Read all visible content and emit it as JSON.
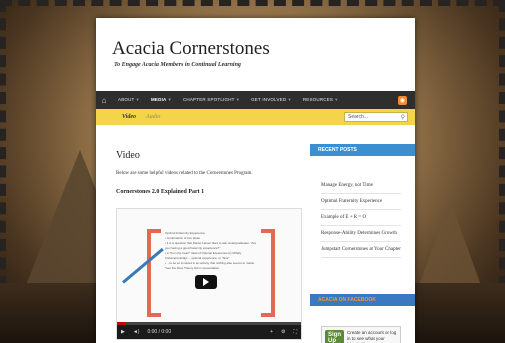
{
  "site": {
    "title": "Acacia Cornerstones",
    "tagline": "To Engage Acacia Members in Continual Learning"
  },
  "nav": {
    "home_icon": "home-icon",
    "items": [
      {
        "label": "ABOUT",
        "caret": "▾"
      },
      {
        "label": "MEDIA",
        "caret": "▾"
      },
      {
        "label": "CHAPTER SPOTLIGHT",
        "caret": "▾"
      },
      {
        "label": "GET INVOLVED",
        "caret": "▾"
      },
      {
        "label": "RESOURCES",
        "caret": "▾"
      }
    ],
    "rss_icon": "rss-icon"
  },
  "subnav": {
    "items": [
      "Video",
      "Audio"
    ],
    "search_placeholder": "Search..."
  },
  "main": {
    "heading": "Video",
    "intro": "Below are some helpful videos related to the Cornerstones Program.",
    "video_title": "Cornerstones 2.0 Explained Part 1"
  },
  "video": {
    "time": "0:00 / 0:00",
    "progress": 0.05,
    "slide_lines": [
      "Optimal Fraternity Experience",
      "• combination of two ideas",
      "• it is a question that Daniel Larsen likes to ask undergraduates: \"Are you having a good fraternity experience?\"",
      "• a \"from the heart\" ideal of Optimal Experience by Mihaly Csikszentmihalyi ... optimal experience, or \"flow\"",
      "• ...to be so involved in an activity that nothing else seems to matter",
      "*see the Flow Theory link in presentation"
    ]
  },
  "sidebar": {
    "recent_posts_title": "RECENT POSTS",
    "recent_posts": [
      "Manage Energy, not Time",
      "Optimal Fraternity Experience",
      "Example of E + R = O",
      "Response-Ability Determines Growth",
      "Jumpstart Cornerstones at Your Chapter"
    ],
    "facebook_title": "ACACIA ON FACEBOOK",
    "facebook_signup": "Sign Up",
    "facebook_text": "Create an account or log in to see what your friends like."
  },
  "colors": {
    "nav_bg": "#2e2e2e",
    "subnav_bg": "#f3d44b",
    "sidebar_banner": "#3b8fd0",
    "accent_orange": "#f28a2e"
  }
}
